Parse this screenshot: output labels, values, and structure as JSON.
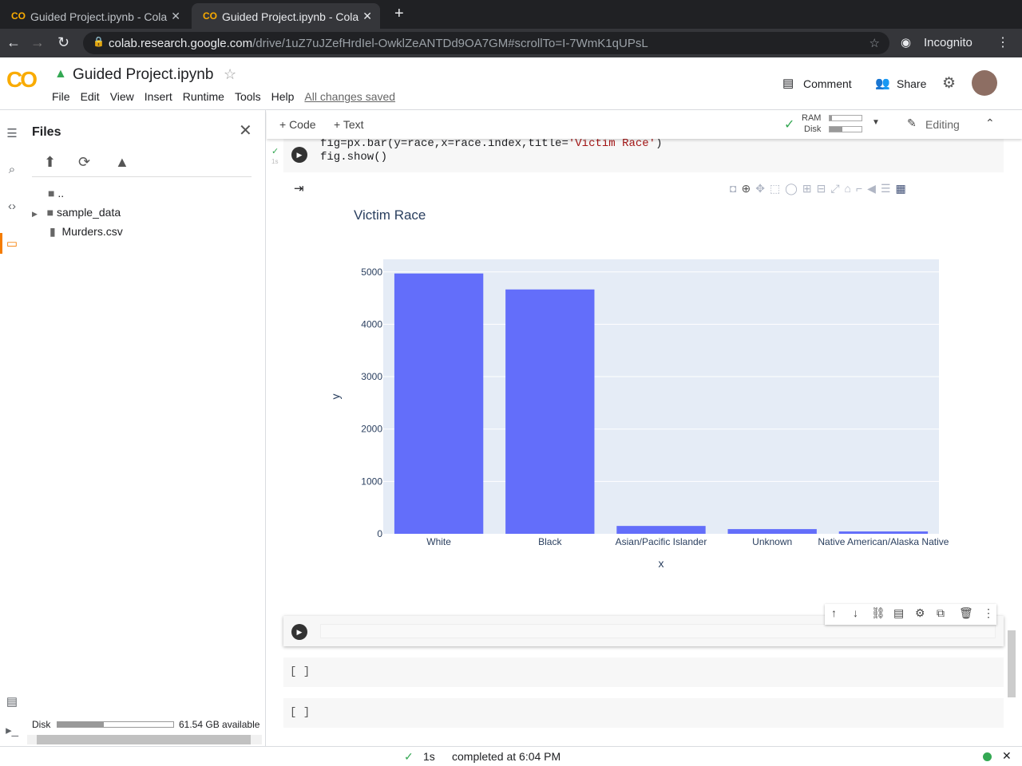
{
  "browser": {
    "tabs": [
      {
        "title": "Guided Project.ipynb - Cola"
      },
      {
        "title": "Guided Project.ipynb - Cola"
      }
    ],
    "url_host": "colab.research.google.com",
    "url_path": "/drive/1uZ7uJZefHrdIel-OwklZeANTDd9OA7GM#scrollTo=I-7WmK1qUPsL",
    "profile": "Incognito"
  },
  "header": {
    "logo": "CO",
    "title": "Guided Project.ipynb",
    "menu": [
      "File",
      "Edit",
      "View",
      "Insert",
      "Runtime",
      "Tools",
      "Help"
    ],
    "saved": "All changes saved",
    "comment": "Comment",
    "share": "Share"
  },
  "toolbar": {
    "code": "+ Code",
    "text": "+ Text",
    "ram": "RAM",
    "disk": "Disk",
    "editing": "Editing"
  },
  "sidebar": {
    "title": "Files",
    "items": [
      {
        "name": ".."
      },
      {
        "name": "sample_data"
      },
      {
        "name": "Murders.csv"
      }
    ],
    "disk_label": "Disk",
    "disk_available": "61.54 GB available",
    "disk_used_fraction": 0.4
  },
  "cell": {
    "code_line1_a": "fig=px.bar(y=race,x=race.index,title=",
    "code_line1_s": "'Victim Race'",
    "code_line1_b": ")",
    "code_line2": "fig.show()",
    "exec_time": "1s"
  },
  "empty_cells": [
    "[ ]",
    "[ ]"
  ],
  "status": {
    "time": "1s",
    "text": "completed at 6:04 PM"
  },
  "colors": {
    "bar": "#636efa",
    "plot_bg": "#e5ecf6"
  },
  "chart_data": {
    "type": "bar",
    "title": "Victim Race",
    "xlabel": "x",
    "ylabel": "y",
    "categories": [
      "White",
      "Black",
      "Asian/Pacific Islander",
      "Unknown",
      "Native American/Alaska Native"
    ],
    "values": [
      4970,
      4665,
      150,
      90,
      45
    ],
    "ylim": [
      0,
      5240
    ],
    "yticks": [
      0,
      1000,
      2000,
      3000,
      4000,
      5000
    ],
    "grid": true
  }
}
